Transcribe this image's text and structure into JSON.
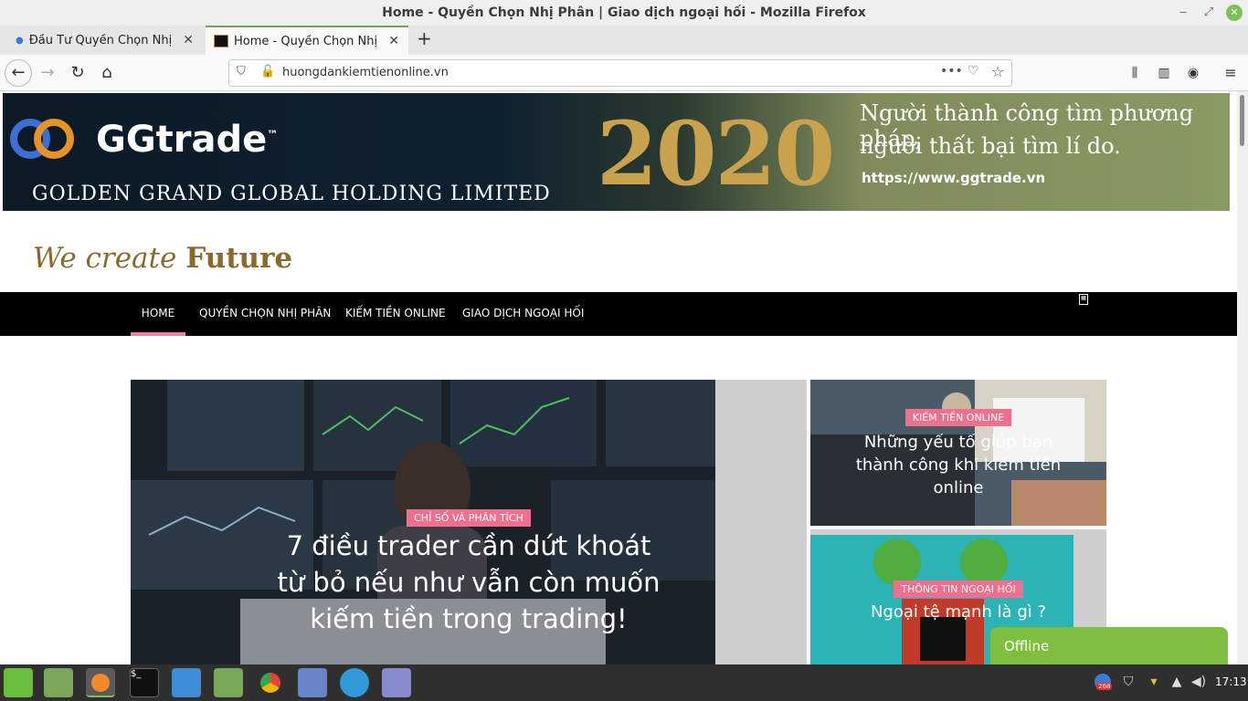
{
  "window": {
    "title": "Home - Quyền Chọn Nhị Phân | Giao dịch ngoại hối - Mozilla Firefox"
  },
  "tabs": [
    {
      "label": "Đầu Tư Quyền Chọn Nhị Phân"
    },
    {
      "label": "Home - Quyền Chọn Nhị Phân"
    }
  ],
  "address": {
    "url": "huongdankiemtienonline.vn"
  },
  "banner": {
    "brand": "GGtrade",
    "tm": "™",
    "company": "GOLDEN GRAND GLOBAL HOLDING LIMITED",
    "year": "2020",
    "quote_line1": "Người thành công tìm phương pháp,",
    "quote_line2": "người thất bại tìm lí do.",
    "url": "https://www.ggtrade.vn"
  },
  "tagline": {
    "part1": "We create",
    "part2": "Future"
  },
  "menu": [
    {
      "label": "HOME"
    },
    {
      "label": "QUYỀN CHỌN NHỊ PHÂN"
    },
    {
      "label": "KIẾM TIỀN ONLINE"
    },
    {
      "label": "GIAO DỊCH NGOẠI HỐI"
    }
  ],
  "featured": {
    "category": "CHỈ SỐ VÀ PHÂN TÍCH",
    "title": "7 điều trader cần dứt khoát từ bỏ nếu như vẫn còn muốn kiếm tiền trong trading!"
  },
  "side_posts": [
    {
      "category": "KIẾM TIỀN ONLINE",
      "title": "Những yếu tố giúp bạn thành công khi kiếm tiền online"
    },
    {
      "category": "THÔNG TIN NGOẠI HỐI",
      "title": "Ngoại tệ mạnh là gì ?"
    }
  ],
  "chat": {
    "status": "Offline"
  },
  "taskbar": {
    "clock": "17:13",
    "badge": "268"
  },
  "colors": {
    "menu_bg": "#000000",
    "accent_pink": "#ef6f8f",
    "chat_green": "#7fbf3f",
    "tagline_gold": "#8a6a2c"
  }
}
